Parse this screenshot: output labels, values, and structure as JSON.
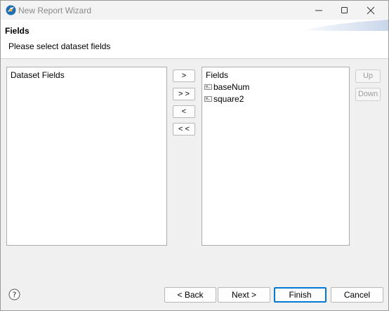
{
  "window": {
    "title": "New Report Wizard"
  },
  "header": {
    "title": "Fields",
    "description": "Please select dataset fields"
  },
  "left_list": {
    "header": "Dataset Fields",
    "items": []
  },
  "right_list": {
    "header": "Fields",
    "items": [
      {
        "label": "baseNum",
        "icon": "field-icon"
      },
      {
        "label": "square2",
        "icon": "field-icon"
      }
    ]
  },
  "movers": {
    "add": ">",
    "add_all": "> >",
    "remove": "<",
    "remove_all": "< <"
  },
  "side_buttons": {
    "up": "Up",
    "down": "Down"
  },
  "footer": {
    "back": "< Back",
    "next": "Next >",
    "finish": "Finish",
    "cancel": "Cancel"
  },
  "colors": {
    "accent": "#0078d4",
    "disabled_text": "#9d9d9d"
  }
}
